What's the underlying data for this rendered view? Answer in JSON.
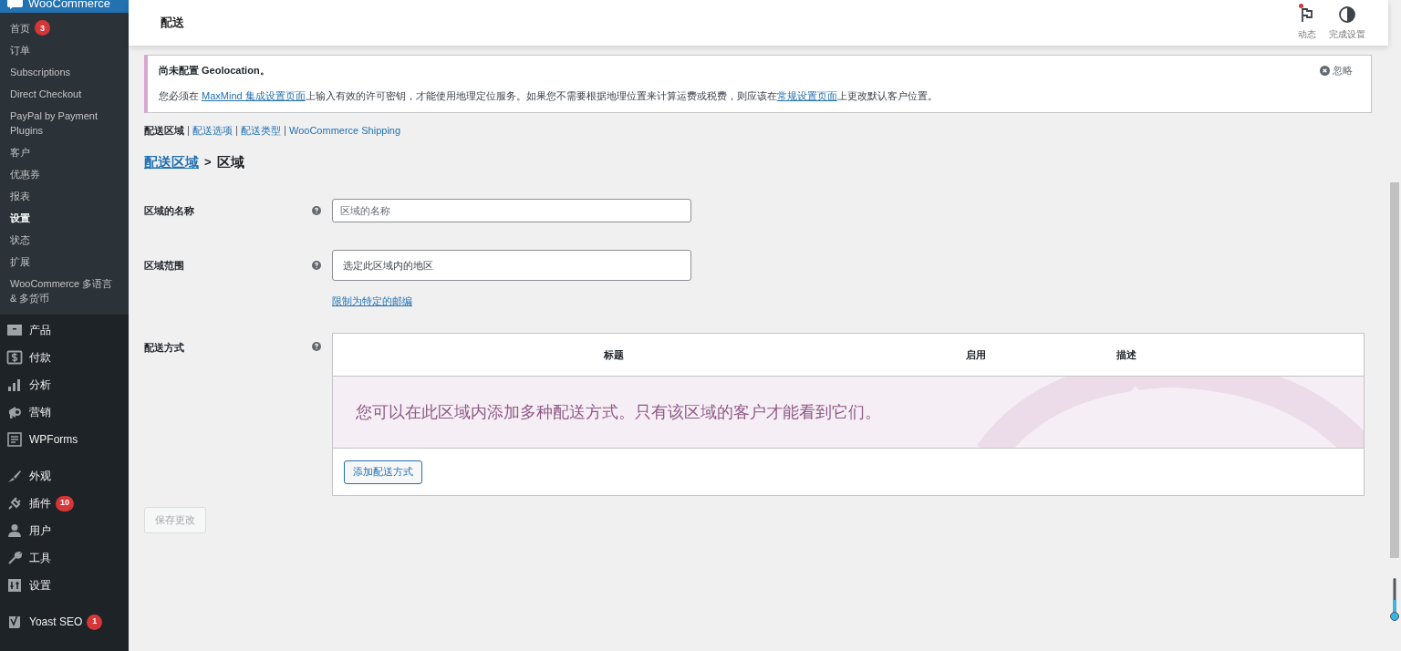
{
  "sidebar": {
    "header": "WooCommerce",
    "submenu": [
      {
        "label": "首页",
        "badge": "3",
        "selected": false
      },
      {
        "label": "订单",
        "selected": false
      },
      {
        "label": "Subscriptions",
        "selected": false
      },
      {
        "label": "Direct Checkout",
        "selected": false
      },
      {
        "label": "PayPal by Payment Plugins",
        "selected": false
      },
      {
        "label": "客户",
        "selected": false
      },
      {
        "label": "优惠券",
        "selected": false
      },
      {
        "label": "报表",
        "selected": false
      },
      {
        "label": "设置",
        "selected": true
      },
      {
        "label": "状态",
        "selected": false
      },
      {
        "label": "扩展",
        "selected": false
      },
      {
        "label": "WooCommerce 多语言 & 多货币",
        "selected": false
      }
    ],
    "menu_groups": [
      [
        {
          "label": "产品"
        },
        {
          "label": "付款"
        },
        {
          "label": "分析"
        },
        {
          "label": "营销"
        },
        {
          "label": "WPForms"
        }
      ],
      [
        {
          "label": "外观"
        },
        {
          "label": "插件",
          "badge": "10"
        },
        {
          "label": "用户"
        },
        {
          "label": "工具"
        },
        {
          "label": "设置"
        }
      ],
      [
        {
          "label": "Yoast SEO",
          "badge": "1"
        }
      ]
    ]
  },
  "header": {
    "title": "配送",
    "actions": [
      {
        "label": "动态",
        "notification": true
      },
      {
        "label": "完成设置",
        "notification": false
      }
    ]
  },
  "notice": {
    "title": "尚未配置 Geolocation。",
    "dismiss": "忽略",
    "message": [
      {
        "kind": "text",
        "text": "您必须在 "
      },
      {
        "kind": "link",
        "text": "MaxMind 集成设置页面"
      },
      {
        "kind": "text",
        "text": "上输入有效的许可密钥，才能使用地理定位服务。如果您不需要根据地理位置来计算运费或税费，则应该在"
      },
      {
        "kind": "link",
        "text": "常规设置页面"
      },
      {
        "kind": "text",
        "text": "上更改默认客户位置。"
      }
    ]
  },
  "tabs": [
    {
      "label": "配送区域",
      "selected": true
    },
    {
      "label": "配送选项",
      "selected": false
    },
    {
      "label": "配送类型",
      "selected": false
    },
    {
      "label": "WooCommerce Shipping",
      "selected": false
    }
  ],
  "breadcrumb": {
    "link": "配送区域",
    "separator": ">",
    "current": "区域"
  },
  "form": {
    "zone_name": {
      "label": "区域的名称",
      "placeholder": "区域的名称"
    },
    "zone_regions": {
      "label": "区域范围",
      "placeholder": "选定此区域内的地区",
      "link": "限制为特定的邮编"
    },
    "shipping_methods": {
      "label": "配送方式",
      "columns": [
        "标题",
        "启用",
        "描述"
      ],
      "empty_message": "您可以在此区域内添加多种配送方式。只有该区域的客户才能看到它们。",
      "add_button": "添加配送方式"
    }
  },
  "save_button": {
    "label": "保存更改",
    "disabled": true
  }
}
